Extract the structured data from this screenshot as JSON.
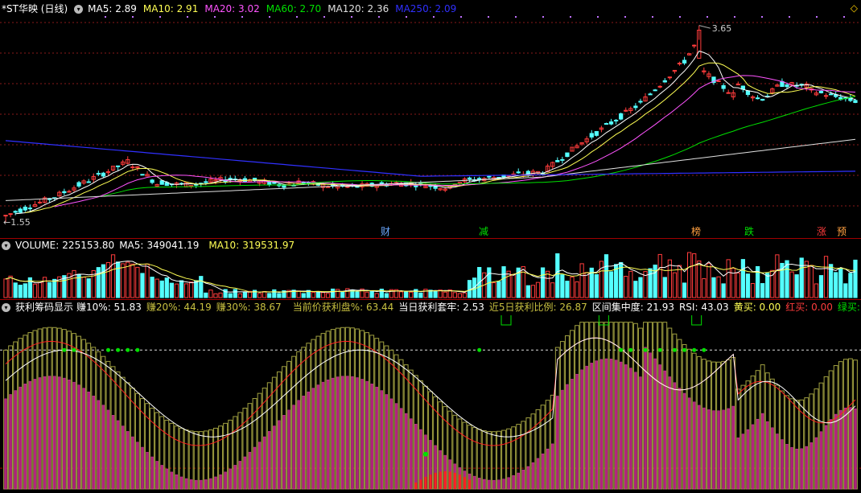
{
  "colors": {
    "up": "#ff3c3c",
    "down": "#54ffff",
    "ma5": "#ffffff",
    "ma10": "#ffff54",
    "ma20": "#ff54ff",
    "ma60": "#00e000",
    "ma120": "#e0e0e0",
    "ma250": "#3030ff",
    "grid": "#8a1a1a",
    "tag": "#c070ff"
  },
  "main": {
    "title": "*ST华映 (日线)",
    "indicators": [
      {
        "label": "MA5:",
        "value": "2.89",
        "color": "#ffffff"
      },
      {
        "label": "MA10:",
        "value": "2.91",
        "color": "#ffff54"
      },
      {
        "label": "MA20:",
        "value": "3.02",
        "color": "#ff54ff"
      },
      {
        "label": "MA60:",
        "value": "2.70",
        "color": "#00e000"
      },
      {
        "label": "MA120:",
        "value": "2.36",
        "color": "#e0e0e0"
      },
      {
        "label": "MA250:",
        "value": "2.09",
        "color": "#3030ff"
      }
    ],
    "high_label": "3.65",
    "low_label": "1.55",
    "events": [
      {
        "text": "财",
        "color": "#6aa8ff"
      },
      {
        "text": "减",
        "color": "#00e000"
      },
      {
        "text": "榜",
        "color": "#ffa040"
      },
      {
        "text": "跌",
        "color": "#00e000"
      },
      {
        "text": "涨",
        "color": "#ff3c3c"
      },
      {
        "text": "预",
        "color": "#ffa040"
      }
    ]
  },
  "volume": {
    "label": "VOLUME:",
    "value": "225153.80",
    "ma5_label": "MA5:",
    "ma5_value": "349041.19",
    "ma10_label": "MA10:",
    "ma10_value": "319531.97"
  },
  "chip": {
    "name": "获利筹码显示",
    "items": [
      {
        "label": "赚10%:",
        "value": "51.83",
        "color": "#ffffff"
      },
      {
        "label": "赚20%:",
        "value": "44.19",
        "color": "#c8c040"
      },
      {
        "label": "赚30%:",
        "value": "38.67",
        "color": "#c8c040"
      },
      {
        "label": "当前价获利盘%:",
        "value": "63.44",
        "color": "#c8c040"
      },
      {
        "label": "当日获利套牢:",
        "value": "2.53",
        "color": "#ffffff"
      },
      {
        "label": "近5日获利比例:",
        "value": "26.87",
        "color": "#c8c040"
      },
      {
        "label": "区间集中度:",
        "value": "21.93",
        "color": "#ffffff"
      },
      {
        "label": "RSI:",
        "value": "43.03",
        "color": "#ffffff"
      },
      {
        "label": "黄买:",
        "value": "0.00",
        "color": "#ffff54"
      },
      {
        "label": "红买:",
        "value": "0.00",
        "color": "#ff3c3c"
      },
      {
        "label": "绿买:",
        "value": "0.00",
        "color": "#00e000"
      }
    ]
  },
  "chart_data": [
    {
      "type": "candlestick",
      "title": "*ST华映 (日线)",
      "series": [
        {
          "name": "MA5",
          "value": 2.89
        },
        {
          "name": "MA10",
          "value": 2.91
        },
        {
          "name": "MA20",
          "value": 3.02
        },
        {
          "name": "MA60",
          "value": 2.7
        },
        {
          "name": "MA120",
          "value": 2.36
        },
        {
          "name": "MA250",
          "value": 2.09
        }
      ],
      "annotations": {
        "max": 3.65,
        "min": 1.55
      },
      "ylim": [
        1.5,
        3.75
      ],
      "grid": true
    },
    {
      "type": "bar",
      "title": "VOLUME",
      "series": [
        {
          "name": "VOLUME",
          "value": 225153.8
        },
        {
          "name": "MA5",
          "value": 349041.19
        },
        {
          "name": "MA10",
          "value": 319531.97
        }
      ]
    },
    {
      "type": "bar",
      "title": "获利筹码显示",
      "ylim": [
        0,
        100
      ],
      "series": [
        {
          "name": "赚10%",
          "value": 51.83
        },
        {
          "name": "赚20%",
          "value": 44.19
        },
        {
          "name": "赚30%",
          "value": 38.67
        },
        {
          "name": "当前价获利盘%",
          "value": 63.44
        },
        {
          "name": "当日获利套牢",
          "value": 2.53
        },
        {
          "name": "近5日获利比例",
          "value": 26.87
        },
        {
          "name": "区间集中度",
          "value": 21.93
        },
        {
          "name": "RSI",
          "value": 43.03
        },
        {
          "name": "黄买",
          "value": 0.0
        },
        {
          "name": "红买",
          "value": 0.0
        },
        {
          "name": "绿买",
          "value": 0.0
        }
      ]
    }
  ]
}
